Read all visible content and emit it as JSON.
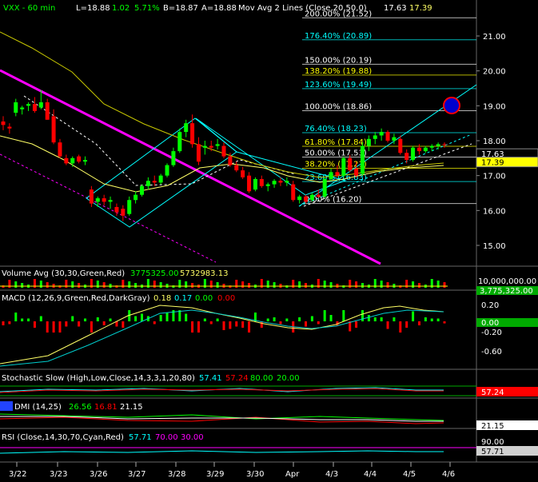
{
  "header": {
    "symbol": "VXX",
    "interval": "60 min",
    "low": "L=18.88",
    "change": "1.02",
    "pct": "5.71%",
    "bid": "B=18.87",
    "ask": "A=18.88",
    "study": "Mov Avg 2 Lines (Close,20,50,0)",
    "ma1": "17.63",
    "ma2": "17.39"
  },
  "colors": {
    "background": "#000000",
    "up_candle": "#00ff00",
    "down_candle": "#ff0000",
    "magenta_channel": "#ff00ff",
    "cyan_lines": "#00ffff",
    "ma_yellow": "#ffff66",
    "fib_text": "#ffff00"
  },
  "chart_data": [
    {
      "type": "candlestick",
      "name": "VXX price (60 min)",
      "ylim": [
        14.2,
        21.6
      ],
      "y_ticks": [
        "21.00",
        "20.00",
        "19.00",
        "18.00",
        "17.00",
        "16.00",
        "15.00"
      ],
      "x_labels": [
        "3/22",
        "3/23",
        "3/26",
        "3/27",
        "3/28",
        "3/29",
        "3/30",
        "Apr",
        "4/3",
        "4/4",
        "4/5",
        "4/6"
      ],
      "price_labels": [
        {
          "value": 17.63,
          "text": "17.63",
          "bg": "#000000",
          "fg": "#ffffff"
        },
        {
          "value": 17.39,
          "text": "17.39",
          "bg": "#ffff00",
          "fg": "#000000"
        }
      ],
      "candles": [
        {
          "o": 18.55,
          "h": 18.7,
          "l": 18.3,
          "c": 18.45
        },
        {
          "o": 18.4,
          "h": 18.5,
          "l": 18.2,
          "c": 18.35
        },
        {
          "o": 18.8,
          "h": 19.2,
          "l": 18.7,
          "c": 19.1
        },
        {
          "o": 18.9,
          "h": 19.0,
          "l": 18.75,
          "c": 18.95
        },
        {
          "o": 19.0,
          "h": 19.1,
          "l": 18.85,
          "c": 19.05
        },
        {
          "o": 19.05,
          "h": 19.25,
          "l": 18.8,
          "c": 18.85
        },
        {
          "o": 18.95,
          "h": 19.45,
          "l": 18.9,
          "c": 19.1
        },
        {
          "o": 19.1,
          "h": 19.2,
          "l": 18.6,
          "c": 18.6
        },
        {
          "o": 18.7,
          "h": 18.9,
          "l": 17.9,
          "c": 17.95
        },
        {
          "o": 17.95,
          "h": 18.05,
          "l": 17.5,
          "c": 17.55
        },
        {
          "o": 17.5,
          "h": 17.6,
          "l": 17.3,
          "c": 17.35
        },
        {
          "o": 17.35,
          "h": 17.55,
          "l": 17.25,
          "c": 17.5
        },
        {
          "o": 17.55,
          "h": 17.6,
          "l": 17.35,
          "c": 17.4
        },
        {
          "o": 17.4,
          "h": 17.55,
          "l": 17.3,
          "c": 17.45
        },
        {
          "o": 16.6,
          "h": 16.7,
          "l": 16.1,
          "c": 16.2
        },
        {
          "o": 16.25,
          "h": 16.4,
          "l": 16.1,
          "c": 16.35
        },
        {
          "o": 16.35,
          "h": 16.45,
          "l": 16.15,
          "c": 16.25
        },
        {
          "o": 16.25,
          "h": 16.4,
          "l": 16.05,
          "c": 16.3
        },
        {
          "o": 16.1,
          "h": 16.2,
          "l": 15.85,
          "c": 15.95
        },
        {
          "o": 16.05,
          "h": 16.15,
          "l": 15.7,
          "c": 15.85
        },
        {
          "o": 15.9,
          "h": 16.4,
          "l": 15.85,
          "c": 16.3
        },
        {
          "o": 16.3,
          "h": 16.55,
          "l": 16.2,
          "c": 16.45
        },
        {
          "o": 16.45,
          "h": 16.75,
          "l": 16.4,
          "c": 16.7
        },
        {
          "o": 16.7,
          "h": 16.95,
          "l": 16.6,
          "c": 16.85
        },
        {
          "o": 16.85,
          "h": 17.0,
          "l": 16.7,
          "c": 16.8
        },
        {
          "o": 16.8,
          "h": 17.05,
          "l": 16.75,
          "c": 17.0
        },
        {
          "o": 17.0,
          "h": 17.35,
          "l": 16.95,
          "c": 17.3
        },
        {
          "o": 17.3,
          "h": 17.8,
          "l": 17.25,
          "c": 17.7
        },
        {
          "o": 17.7,
          "h": 18.35,
          "l": 17.65,
          "c": 18.25
        },
        {
          "o": 18.25,
          "h": 18.6,
          "l": 18.1,
          "c": 18.5
        },
        {
          "o": 18.5,
          "h": 18.75,
          "l": 17.8,
          "c": 17.9
        },
        {
          "o": 17.9,
          "h": 18.1,
          "l": 17.3,
          "c": 17.4
        },
        {
          "o": 17.8,
          "h": 18.0,
          "l": 17.6,
          "c": 17.85
        },
        {
          "o": 17.85,
          "h": 18.0,
          "l": 17.7,
          "c": 17.8
        },
        {
          "o": 17.85,
          "h": 18.05,
          "l": 17.75,
          "c": 17.9
        },
        {
          "o": 17.85,
          "h": 17.95,
          "l": 17.5,
          "c": 17.55
        },
        {
          "o": 17.55,
          "h": 17.65,
          "l": 17.25,
          "c": 17.3
        },
        {
          "o": 17.3,
          "h": 17.4,
          "l": 17.1,
          "c": 17.15
        },
        {
          "o": 17.15,
          "h": 17.25,
          "l": 16.9,
          "c": 16.95
        },
        {
          "o": 17.0,
          "h": 17.1,
          "l": 16.5,
          "c": 16.55
        },
        {
          "o": 16.6,
          "h": 16.95,
          "l": 16.55,
          "c": 16.9
        },
        {
          "o": 16.9,
          "h": 17.0,
          "l": 16.65,
          "c": 16.7
        },
        {
          "o": 16.7,
          "h": 16.8,
          "l": 16.55,
          "c": 16.75
        },
        {
          "o": 16.75,
          "h": 16.9,
          "l": 16.65,
          "c": 16.85
        },
        {
          "o": 16.85,
          "h": 16.95,
          "l": 16.7,
          "c": 16.8
        },
        {
          "o": 16.8,
          "h": 16.95,
          "l": 16.7,
          "c": 16.85
        },
        {
          "o": 16.75,
          "h": 16.85,
          "l": 16.25,
          "c": 16.3
        },
        {
          "o": 16.3,
          "h": 16.45,
          "l": 16.2,
          "c": 16.4
        },
        {
          "o": 16.4,
          "h": 16.45,
          "l": 16.2,
          "c": 16.25
        },
        {
          "o": 16.3,
          "h": 16.5,
          "l": 16.25,
          "c": 16.45
        },
        {
          "o": 16.45,
          "h": 16.6,
          "l": 16.35,
          "c": 16.4
        },
        {
          "o": 16.4,
          "h": 16.95,
          "l": 16.35,
          "c": 16.9
        },
        {
          "o": 16.9,
          "h": 17.2,
          "l": 16.85,
          "c": 17.1
        },
        {
          "o": 17.1,
          "h": 17.3,
          "l": 16.95,
          "c": 17.0
        },
        {
          "o": 17.0,
          "h": 17.55,
          "l": 16.95,
          "c": 17.5
        },
        {
          "o": 17.5,
          "h": 17.6,
          "l": 17.1,
          "c": 17.15
        },
        {
          "o": 17.2,
          "h": 17.4,
          "l": 16.95,
          "c": 17.0
        },
        {
          "o": 17.05,
          "h": 17.95,
          "l": 17.0,
          "c": 17.85
        },
        {
          "o": 17.85,
          "h": 18.15,
          "l": 17.7,
          "c": 18.05
        },
        {
          "o": 18.05,
          "h": 18.25,
          "l": 17.9,
          "c": 18.15
        },
        {
          "o": 18.15,
          "h": 18.35,
          "l": 18.0,
          "c": 18.25
        },
        {
          "o": 18.25,
          "h": 18.3,
          "l": 17.95,
          "c": 18.0
        },
        {
          "o": 18.0,
          "h": 18.2,
          "l": 17.9,
          "c": 18.1
        },
        {
          "o": 18.05,
          "h": 18.15,
          "l": 17.6,
          "c": 17.65
        },
        {
          "o": 17.65,
          "h": 17.75,
          "l": 17.35,
          "c": 17.45
        },
        {
          "o": 17.45,
          "h": 17.85,
          "l": 17.4,
          "c": 17.8
        },
        {
          "o": 17.8,
          "h": 17.9,
          "l": 17.6,
          "c": 17.7
        },
        {
          "o": 17.7,
          "h": 17.85,
          "l": 17.65,
          "c": 17.8
        },
        {
          "o": 17.8,
          "h": 17.9,
          "l": 17.7,
          "c": 17.85
        },
        {
          "o": 17.85,
          "h": 17.95,
          "l": 17.75,
          "c": 17.9
        },
        {
          "o": 17.9,
          "h": 17.95,
          "l": 17.8,
          "c": 17.88
        }
      ],
      "fib_levels": [
        {
          "value": 21.52,
          "text": "200.00% (21.52)",
          "color": "#ffffff"
        },
        {
          "value": 20.89,
          "text": "176.40% (20.89)",
          "color": "#00ffff"
        },
        {
          "value": 20.19,
          "text": "150.00% (20.19)",
          "color": "#ffffff"
        },
        {
          "value": 19.88,
          "text": "138.20% (19.88)",
          "color": "#ffff00"
        },
        {
          "value": 19.49,
          "text": "123.60% (19.49)",
          "color": "#00ffff"
        },
        {
          "value": 18.86,
          "text": "100.00% (18.86)",
          "color": "#ffffff"
        },
        {
          "value": 18.23,
          "text": "76.40% (18.23)",
          "color": "#00ffff"
        },
        {
          "value": 17.84,
          "text": "61.80% (17.84)",
          "color": "#ffff00"
        },
        {
          "value": 17.53,
          "text": "50.00% (17.53)",
          "color": "#ffffff"
        },
        {
          "value": 17.21,
          "text": "38.20% (17.21)",
          "color": "#ffff00"
        },
        {
          "value": 16.83,
          "text": "23.60% (16.83)",
          "color": "#00ffff"
        },
        {
          "value": 16.2,
          "text": "0.00% (16.20)",
          "color": "#ffffff"
        }
      ]
    },
    {
      "type": "bar",
      "name": "Volume Avg (30,30,Green,Red)",
      "values_label": [
        "3775325.00",
        "5732983.13"
      ],
      "y_labels": [
        "10,000,000.00",
        "3,775,325.00"
      ]
    },
    {
      "type": "line",
      "name": "MACD (12,26,9,Green,Red,DarkGray)",
      "values_label": [
        "0.18",
        "0.17",
        "0.00",
        "0.00"
      ],
      "y_labels": [
        "0.20",
        "0.00",
        "-0.20",
        "-0.60"
      ]
    },
    {
      "type": "line",
      "name": "Stochastic Slow (High,Low,Close,14,3,3,1,20,80)",
      "values_label": [
        "57.41",
        "57.24",
        "80.00",
        "20.00"
      ],
      "y_labels": [
        "57.24"
      ]
    },
    {
      "type": "line",
      "name": "DMI (14,25)",
      "values_label": [
        "26.56",
        "16.81",
        "21.15"
      ],
      "y_labels": [
        "21.15"
      ]
    },
    {
      "type": "line",
      "name": "RSI (Close,14,30,70,Cyan,Red)",
      "values_label": [
        "57.71",
        "70.00",
        "30.00"
      ],
      "y_labels": [
        "90.00",
        "57.71"
      ]
    }
  ]
}
